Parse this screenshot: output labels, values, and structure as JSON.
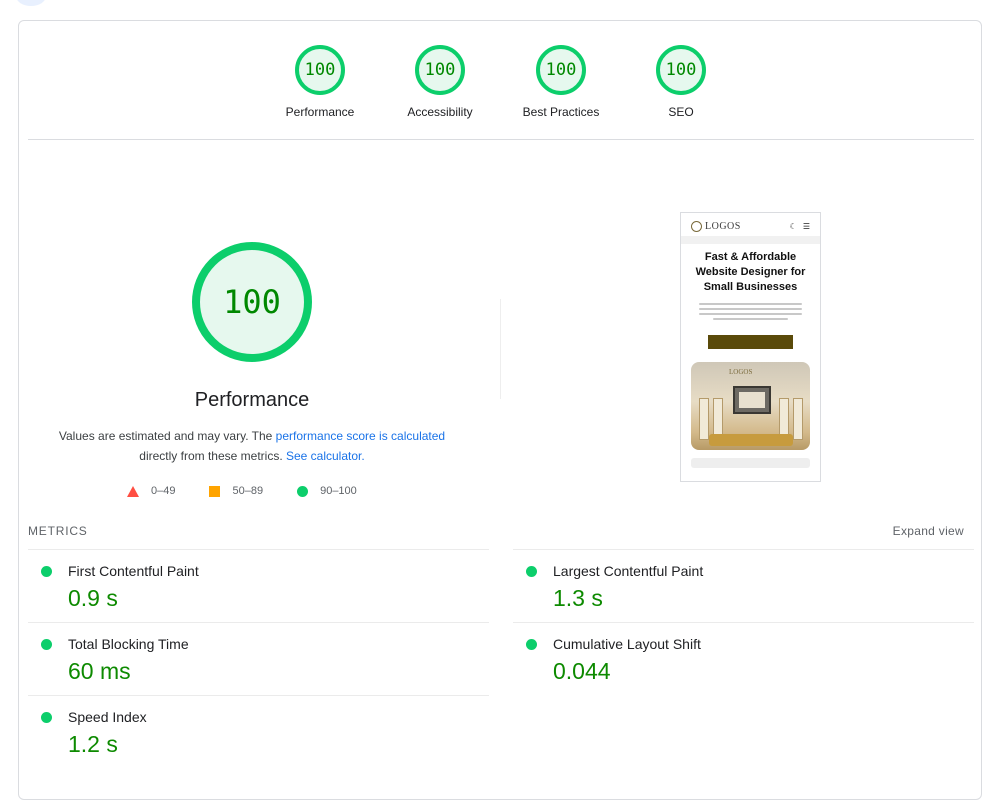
{
  "categories": [
    {
      "label": "Performance",
      "score": "100"
    },
    {
      "label": "Accessibility",
      "score": "100"
    },
    {
      "label": "Best Practices",
      "score": "100"
    },
    {
      "label": "SEO",
      "score": "100"
    }
  ],
  "main": {
    "score": "100",
    "title": "Performance",
    "desc_prefix": "Values are estimated and may vary. The ",
    "desc_link": "performance score is calculated",
    "desc_mid": " directly from these metrics. ",
    "desc_link2": "See calculator.",
    "legend": [
      "0–49",
      "50–89",
      "90–100"
    ]
  },
  "preview": {
    "logo_text": "LOGOS",
    "headline": "Fast & Affordable Website Designer for Small Businesses",
    "image_logo": "LOGOS"
  },
  "metrics": {
    "section_label": "METRICS",
    "expand_label": "Expand view",
    "items": [
      {
        "name": "First Contentful Paint",
        "value": "0.9 s"
      },
      {
        "name": "Largest Contentful Paint",
        "value": "1.3 s"
      },
      {
        "name": "Total Blocking Time",
        "value": "60 ms"
      },
      {
        "name": "Cumulative Layout Shift",
        "value": "0.044"
      },
      {
        "name": "Speed Index",
        "value": "1.2 s"
      }
    ]
  },
  "colors": {
    "pass": "#0cce6b",
    "average": "#ffa400",
    "fail": "#ff4e42",
    "link": "#1a73e8"
  }
}
